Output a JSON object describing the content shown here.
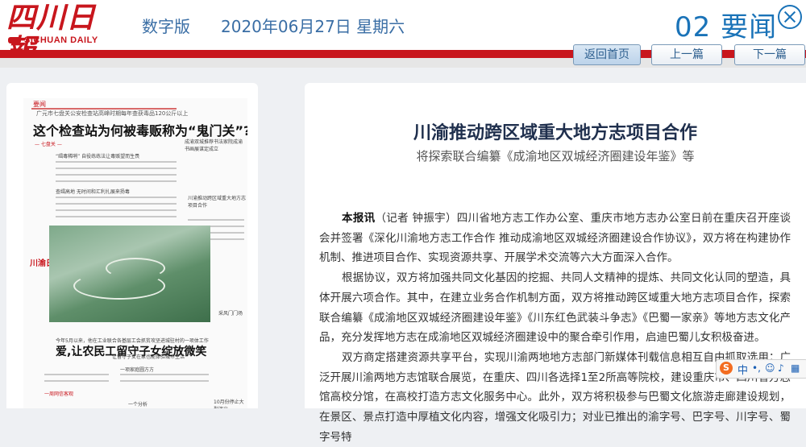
{
  "header": {
    "logo_cn": "四川日報",
    "logo_en": "SICHUAN DAILY",
    "edition": "数字版",
    "date": "2020年06月27日 星期六",
    "section": "02 要闻"
  },
  "nav": {
    "home": "返回首页",
    "prev": "上一篇",
    "next": "下一篇"
  },
  "thumbnail": {
    "head_a": "要闻",
    "head_b": "广元市七盘关公安检查站高峰时期每年查获毒品120公斤以上",
    "headline": "这个检查站为何被毒贩称为“鬼门关”?",
    "sub1": "“缉毒稀哨” 自役练练法让毒贩望而生畏",
    "sub2": "查缉高地 无时间和汇利扎展来扬毒",
    "sub3": "— 七盘关 —",
    "side1": "成渝双城推荐书法家院成渝书画展谋定成立",
    "side2": "川渝推动跨区域重大地方志项目合作",
    "tag": "川渝日报",
    "h2a": "今年5月以来，他在工业联合各基层工会抓贫攻坚进城驻村的一项体工作",
    "h2": "爱,让农民工留守子女绽放微笑",
    "s1": "一项家庭圆方方",
    "s2": "一周网信客观",
    "s3": "一个分析",
    "s4": "采风门门场",
    "s5": "让留守子女在家也能体验城市生活",
    "s6": "10月份停止大型演出"
  },
  "article": {
    "title": "川渝推动跨区域重大地方志项目合作",
    "subtitle": "将探索联合编纂《成渝地区双城经济圈建设年鉴》等",
    "p1_lead": "本报讯",
    "p1": "（记者 钟振宇）四川省地方志工作办公室、重庆市地方志办公室日前在重庆召开座谈会并签署《深化川渝地方志工作合作 推动成渝地区双城经济圈建设合作协议》，双方将在构建协作机制、推进项目合作、实现资源共享、开展学术交流等六大方面深入合作。",
    "p2": "根据协议，双方将加强共同文化基因的挖掘、共同人文精神的提炼、共同文化认同的塑造，具体开展六项合作。其中，在建立业务合作机制方面，双方将推动跨区域重大地方志项目合作，探索联合编纂《成渝地区双城经济圈建设年鉴》《川东红色武装斗争志》《巴蜀一家亲》等地方志文化产品，充分发挥地方志在成渝地区双城经济圈建设中的聚合牵引作用，启迪巴蜀儿女积极奋进。",
    "p3": "双方商定搭建资源共享平台，实现川渝两地地方志部门新媒体刊载信息相互自由抓取选用；广泛开展川渝两地方志馆联合展览，在重庆、四川各选择1至2所高等院校，建设重庆市、四川省方志馆高校分馆，在高校打造方志文化服务中心。此外，双方将积极参与巴蜀文化旅游走廊建设规划，在景区、景点打造中厚植文化内容，增强文化吸引力；对业已推出的渝字号、巴字号、川字号、蜀字号特"
  },
  "ime": {
    "logo": "S",
    "mode": "中"
  }
}
